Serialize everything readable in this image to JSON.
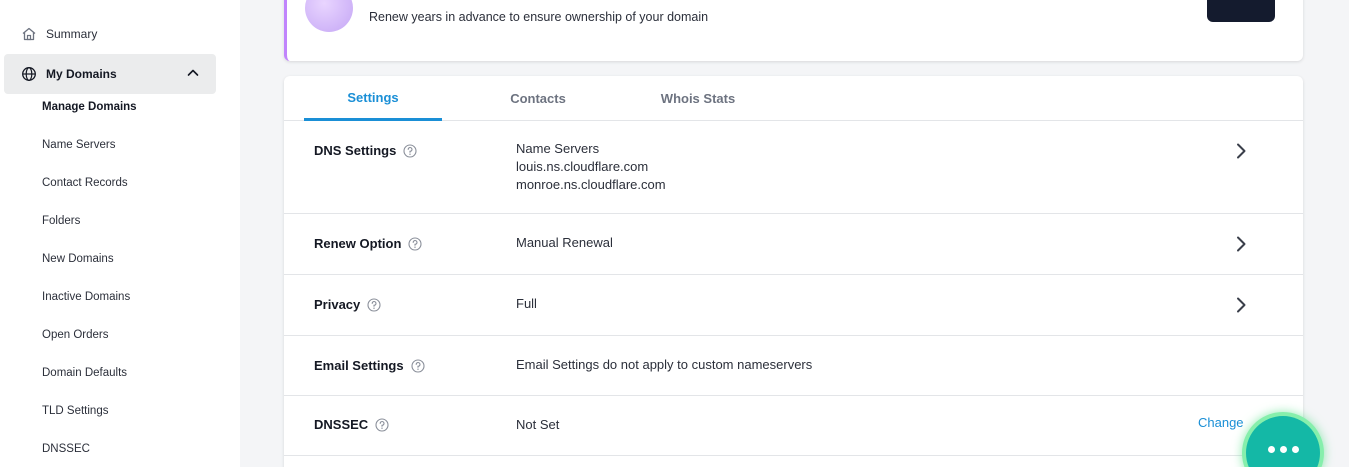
{
  "sidebar": {
    "summary": "Summary",
    "my_domains": "My Domains",
    "items": [
      "Manage Domains",
      "Name Servers",
      "Contact Records",
      "Folders",
      "New Domains",
      "Inactive Domains",
      "Open Orders",
      "Domain Defaults",
      "TLD Settings",
      "DNSSEC"
    ]
  },
  "promo": {
    "text": "Renew years in advance to ensure ownership of your domain"
  },
  "tabs": [
    "Settings",
    "Contacts",
    "Whois Stats"
  ],
  "settings": {
    "dns": {
      "label": "DNS Settings",
      "line1": "Name Servers",
      "line2": "louis.ns.cloudflare.com",
      "line3": "monroe.ns.cloudflare.com"
    },
    "renew": {
      "label": "Renew Option",
      "value": "Manual Renewal"
    },
    "privacy": {
      "label": "Privacy",
      "value": "Full"
    },
    "email": {
      "label": "Email Settings",
      "value": "Email Settings do not apply to custom nameservers"
    },
    "dnssec": {
      "label": "DNSSEC",
      "value": "Not Set",
      "action": "Change"
    }
  },
  "colors": {
    "accent": "#1a8fd6",
    "promo_border": "#c084fc",
    "chat_button": "#14b8a6"
  }
}
